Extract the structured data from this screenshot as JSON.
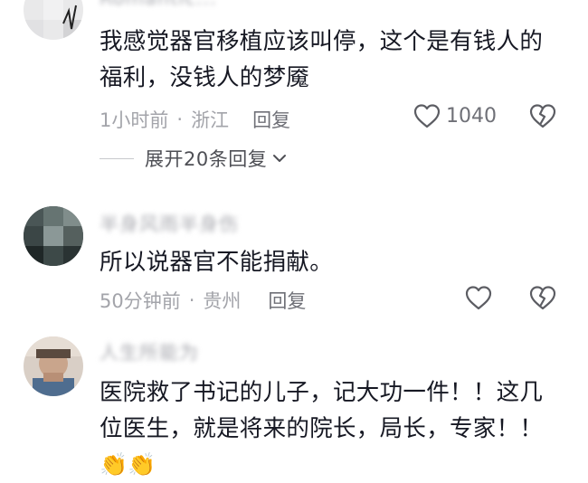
{
  "comments": [
    {
      "username": "Romantic...",
      "text": "我感觉器官移植应该叫停，这个是有钱人的福利，没钱人的梦魇",
      "time": "1小时前",
      "location": "浙江",
      "reply_label": "回复",
      "like_count": "1040",
      "expand_label": "展开20条回复"
    },
    {
      "username": "半身风雨半身伤",
      "text": "所以说器官不能捐献。",
      "time": "50分钟前",
      "location": "贵州",
      "reply_label": "回复"
    },
    {
      "username": "人生所能为",
      "text": "医院救了书记的儿子，记大功一件！！这几位医生，就是将来的院长，局长，专家！！",
      "emoji": "👏👏"
    }
  ],
  "separator": "·",
  "icons": {
    "like": "heart-outline-icon",
    "dislike": "broken-heart-icon",
    "expand": "chevron-down-icon"
  },
  "colors": {
    "text": "#161823",
    "meta": "#a3a4aa",
    "action": "#6f7077"
  }
}
